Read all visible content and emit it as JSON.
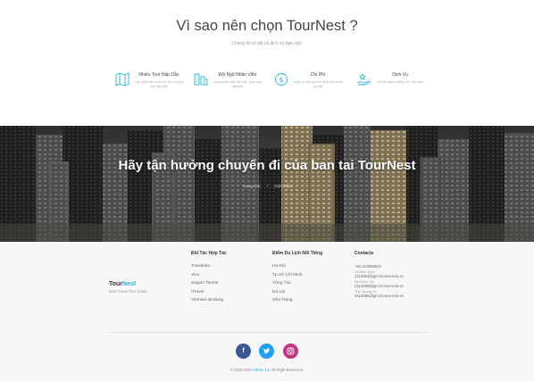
{
  "why": {
    "title": "Vì sao nên chọn TourNest ?",
    "subtitle": "Chúng tôi có tất cả dịch vụ bạn cần.",
    "features": [
      {
        "title": "Nhiều Tour Hấp Dẫn",
        "desc": "Các điểm đến mới mẻ, thú vị đang chờ đón bạn",
        "icon": "map-icon"
      },
      {
        "title": "Đội Ngũ Nhân Viên",
        "desc": "Hướng dẫn viên tận tâm, giàu kinh nghiệm",
        "icon": "team-icon"
      },
      {
        "title": "Chi Phí",
        "desc": "Luôn có mức giá tốt nhất với nhiều ưu đãi",
        "icon": "money-icon"
      },
      {
        "title": "Dịch Vụ",
        "desc": "Hỗ trợ khách hàng 24/7 chu đáo",
        "icon": "service-icon"
      }
    ]
  },
  "hero": {
    "title": "Hãy tận hưởng chuyến đi của ban tai TourNest",
    "crumbs": [
      "Trang chủ",
      "Giới thiệu"
    ]
  },
  "footer": {
    "brand": {
      "name_main": "Tour",
      "name_accent": "Nest",
      "tagline": "Best Travel Tour Guide"
    },
    "partners": {
      "title": "Đối Tác Hợp Tác",
      "items": [
        "Traveloka",
        "Vivu",
        "Saigon Tourist",
        "iTravel",
        "Vietnam Booking"
      ]
    },
    "destinations": {
      "title": "Điểm Du Lịch Nổi Tiếng",
      "items": [
        "Hà Nội",
        "Tp.Hồ Chí Minh",
        "Vũng Tàu",
        "Đà Lạt",
        "Nha Trang"
      ]
    },
    "contacts": {
      "title": "Contacts",
      "phone": "+84 213599510",
      "people": [
        {
          "name": "Võ Minh Thịnh",
          "email": "2113054@gm.hcmue.edu.vn"
        },
        {
          "name": "Mai Xuân Thọ",
          "email": "2113058@gm.hcmue.edu.vn"
        },
        {
          "name": "Trần Quang Vũ",
          "email": "2113065@gm.hcmue.edu.vn"
        }
      ]
    },
    "social": [
      {
        "name": "facebook",
        "glyph": "f",
        "color": "#3b5998"
      },
      {
        "name": "twitter",
        "glyph": "t",
        "color": "#1da1f2"
      },
      {
        "name": "instagram",
        "glyph": "◎",
        "color": "#c13584"
      }
    ],
    "copyright_pre": "© 2023-2024 ",
    "copyright_accent": "Nhóm 13",
    "copyright_post": ". All Right Reserved."
  },
  "colors": {
    "accent": "#27b3d8"
  }
}
